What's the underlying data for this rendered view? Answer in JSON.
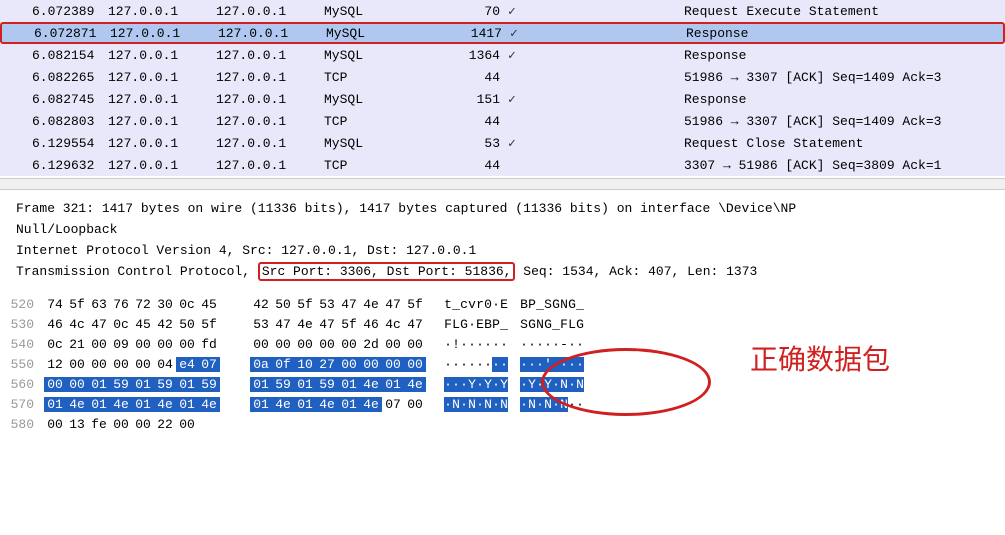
{
  "packets": [
    {
      "time": "6.072389",
      "src": "127.0.0.1",
      "dst": "127.0.0.1",
      "proto": "MySQL",
      "len": "70",
      "check": "✓",
      "info": "Request Execute Statement",
      "cls": "normal"
    },
    {
      "time": "6.072871",
      "src": "127.0.0.1",
      "dst": "127.0.0.1",
      "proto": "MySQL",
      "len": "1417",
      "check": "✓",
      "info": "Response",
      "cls": "highlighted"
    },
    {
      "time": "6.082154",
      "src": "127.0.0.1",
      "dst": "127.0.0.1",
      "proto": "MySQL",
      "len": "1364",
      "check": "✓",
      "info": "Response",
      "cls": "plain"
    },
    {
      "time": "6.082265",
      "src": "127.0.0.1",
      "dst": "127.0.0.1",
      "proto": "TCP",
      "len": "44",
      "check": "",
      "info": "51986 → 3307 [ACK] Seq=1409 Ack=3",
      "cls": "normal"
    },
    {
      "time": "6.082745",
      "src": "127.0.0.1",
      "dst": "127.0.0.1",
      "proto": "MySQL",
      "len": "151",
      "check": "✓",
      "info": "Response",
      "cls": "plain"
    },
    {
      "time": "6.082803",
      "src": "127.0.0.1",
      "dst": "127.0.0.1",
      "proto": "TCP",
      "len": "44",
      "check": "",
      "info": "51986 → 3307 [ACK] Seq=1409 Ack=3",
      "cls": "normal"
    },
    {
      "time": "6.129554",
      "src": "127.0.0.1",
      "dst": "127.0.0.1",
      "proto": "MySQL",
      "len": "53",
      "check": "✓",
      "info": "Request Close Statement",
      "cls": "normal"
    },
    {
      "time": "6.129632",
      "src": "127.0.0.1",
      "dst": "127.0.0.1",
      "proto": "TCP",
      "len": "44",
      "check": "",
      "info": "3307 → 51986 [ACK] Seq=3809 Ack=1",
      "cls": "plain"
    }
  ],
  "details": {
    "frame": "Frame 321: 1417 bytes on wire (11336 bits), 1417 bytes captured (11336 bits) on interface \\Device\\NP",
    "null": "Null/Loopback",
    "ip": "Internet Protocol Version 4, Src: 127.0.0.1, Dst: 127.0.0.1",
    "tcp_pre": "Transmission Control Protocol, ",
    "tcp_ports": "Src Port: 3306, Dst Port: 51836,",
    "tcp_post": " Seq: 1534, Ack: 407, Len: 1373"
  },
  "hex": [
    {
      "off": "520",
      "b": [
        "74",
        "5f",
        "63",
        "76",
        "72",
        "30",
        "0c",
        "45",
        "",
        "42",
        "50",
        "5f",
        "53",
        "47",
        "4e",
        "47",
        "5f"
      ],
      "sel": [
        0,
        0,
        0,
        0,
        0,
        0,
        0,
        0,
        0,
        0,
        0,
        0,
        0,
        0,
        0,
        0,
        0
      ],
      "a": [
        "t",
        "_",
        "c",
        "v",
        "r",
        "0",
        "·",
        "E",
        "",
        "B",
        "P",
        "_",
        "S",
        "G",
        "N",
        "G",
        "_"
      ],
      "asel": [
        0,
        0,
        0,
        0,
        0,
        0,
        0,
        0,
        0,
        0,
        0,
        0,
        0,
        0,
        0,
        0,
        0
      ]
    },
    {
      "off": "530",
      "b": [
        "46",
        "4c",
        "47",
        "0c",
        "45",
        "42",
        "50",
        "5f",
        "",
        "53",
        "47",
        "4e",
        "47",
        "5f",
        "46",
        "4c",
        "47"
      ],
      "sel": [
        0,
        0,
        0,
        0,
        0,
        0,
        0,
        0,
        0,
        0,
        0,
        0,
        0,
        0,
        0,
        0,
        0
      ],
      "a": [
        "F",
        "L",
        "G",
        "·",
        "E",
        "B",
        "P",
        "_",
        "",
        "S",
        "G",
        "N",
        "G",
        "_",
        "F",
        "L",
        "G"
      ],
      "asel": [
        0,
        0,
        0,
        0,
        0,
        0,
        0,
        0,
        0,
        0,
        0,
        0,
        0,
        0,
        0,
        0,
        0
      ]
    },
    {
      "off": "540",
      "b": [
        "0c",
        "21",
        "00",
        "09",
        "00",
        "00",
        "00",
        "fd",
        "",
        "00",
        "00",
        "00",
        "00",
        "00",
        "2d",
        "00",
        "00"
      ],
      "sel": [
        0,
        0,
        0,
        0,
        0,
        0,
        0,
        0,
        0,
        0,
        0,
        0,
        0,
        0,
        0,
        0,
        0
      ],
      "a": [
        "·",
        "!",
        "·",
        "·",
        "·",
        "·",
        "·",
        "·",
        "",
        "·",
        "·",
        "·",
        "·",
        "·",
        "-",
        "·",
        "·"
      ],
      "asel": [
        0,
        0,
        0,
        0,
        0,
        0,
        0,
        0,
        0,
        0,
        0,
        0,
        0,
        0,
        0,
        0,
        0
      ]
    },
    {
      "off": "550",
      "b": [
        "12",
        "00",
        "00",
        "00",
        "00",
        "04",
        "e4",
        "07",
        "",
        "0a",
        "0f",
        "10",
        "27",
        "00",
        "00",
        "00",
        "00"
      ],
      "sel": [
        0,
        0,
        0,
        0,
        0,
        0,
        1,
        1,
        0,
        1,
        1,
        1,
        1,
        1,
        1,
        1,
        1
      ],
      "a": [
        "·",
        "·",
        "·",
        "·",
        "·",
        "·",
        "·",
        "·",
        "",
        "·",
        "·",
        "·",
        "'",
        "·",
        "·",
        "·",
        "·"
      ],
      "asel": [
        0,
        0,
        0,
        0,
        0,
        0,
        1,
        1,
        0,
        1,
        1,
        1,
        1,
        1,
        1,
        1,
        1
      ]
    },
    {
      "off": "560",
      "b": [
        "00",
        "00",
        "01",
        "59",
        "01",
        "59",
        "01",
        "59",
        "",
        "01",
        "59",
        "01",
        "59",
        "01",
        "4e",
        "01",
        "4e"
      ],
      "sel": [
        1,
        1,
        1,
        1,
        1,
        1,
        1,
        1,
        0,
        1,
        1,
        1,
        1,
        1,
        1,
        1,
        1
      ],
      "a": [
        "·",
        "·",
        "·",
        "Y",
        "·",
        "Y",
        "·",
        "Y",
        "",
        "·",
        "Y",
        "·",
        "Y",
        "·",
        "N",
        "·",
        "N"
      ],
      "asel": [
        1,
        1,
        1,
        1,
        1,
        1,
        1,
        1,
        0,
        1,
        1,
        1,
        1,
        1,
        1,
        1,
        1
      ]
    },
    {
      "off": "570",
      "b": [
        "01",
        "4e",
        "01",
        "4e",
        "01",
        "4e",
        "01",
        "4e",
        "",
        "01",
        "4e",
        "01",
        "4e",
        "01",
        "4e",
        "07",
        "00"
      ],
      "sel": [
        1,
        1,
        1,
        1,
        1,
        1,
        1,
        1,
        0,
        1,
        1,
        1,
        1,
        1,
        1,
        0,
        0
      ],
      "a": [
        "·",
        "N",
        "·",
        "N",
        "·",
        "N",
        "·",
        "N",
        "",
        "·",
        "N",
        "·",
        "N",
        "·",
        "N",
        "·",
        "·"
      ],
      "asel": [
        1,
        1,
        1,
        1,
        1,
        1,
        1,
        1,
        0,
        1,
        1,
        1,
        1,
        1,
        1,
        0,
        0
      ]
    },
    {
      "off": "580",
      "b": [
        "00",
        "13",
        "fe",
        "00",
        "00",
        "22",
        "00"
      ],
      "sel": [
        0,
        0,
        0,
        0,
        0,
        0,
        0
      ],
      "a": [],
      "asel": []
    }
  ],
  "annotation": "正确数据包"
}
